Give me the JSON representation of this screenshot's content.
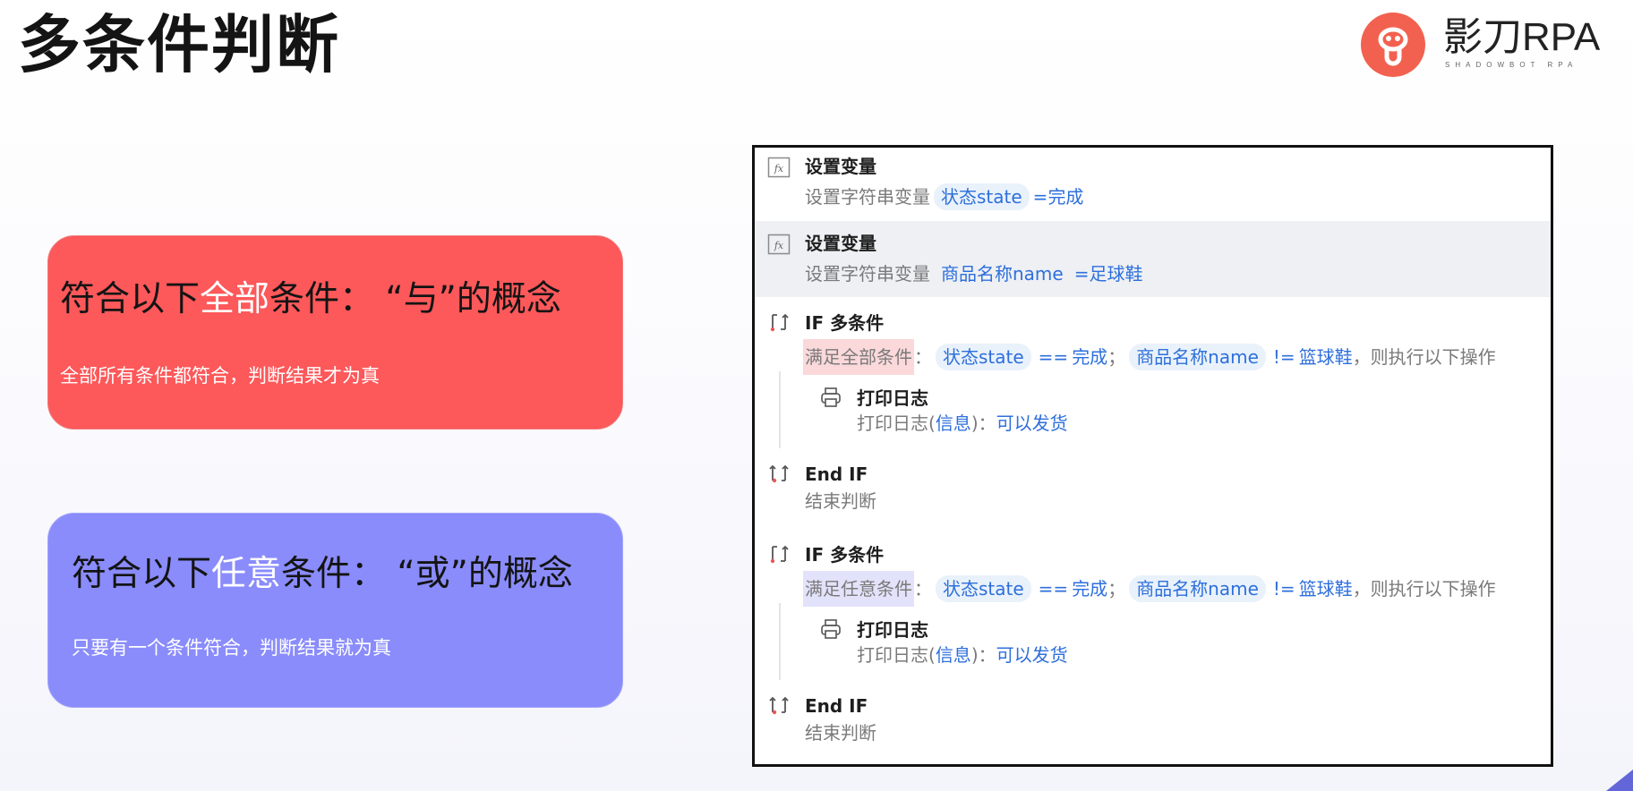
{
  "page_title": "多条件判断",
  "logo": {
    "name": "影刀RPA",
    "subtitle": "SHADOWBOT RPA",
    "brand_color": "#f2614f"
  },
  "cards": {
    "and": {
      "heading_pre": "符合以下",
      "heading_hl": "全部",
      "heading_post": "条件： “与”的概念",
      "desc": "全部所有条件都符合，判断结果才为真",
      "color": "#fd585a"
    },
    "or": {
      "heading_pre": "符合以下",
      "heading_hl": "任意",
      "heading_post": "条件： “或”的概念",
      "desc": "只要有一个条件符合，判断结果就为真",
      "color": "#8a8cfb"
    }
  },
  "flow": {
    "set1": {
      "icon": "fx-icon",
      "title": "设置变量",
      "label": "设置字符串变量",
      "var": "状态state",
      "eq": "=",
      "value": "完成"
    },
    "set2": {
      "icon": "fx-icon",
      "title": "设置变量",
      "label": "设置字符串变量",
      "var": "商品名称name",
      "eq": "=",
      "value": "足球鞋"
    },
    "if1": {
      "icon": "if-branch-icon",
      "title": "IF 多条件",
      "cond_label": "满足全部条件",
      "colon": "：",
      "var1": "状态state",
      "op1": "==",
      "val1": "完成",
      "sep": "；",
      "var2": "商品名称name",
      "op2": "!=",
      "val2": "篮球鞋",
      "suffix": "，则执行以下操作"
    },
    "log1": {
      "icon": "printer-icon",
      "title": "打印日志",
      "label": "打印日志(",
      "param": "信息",
      "close": ")：",
      "value": "可以发货"
    },
    "end1": {
      "icon": "end-if-icon",
      "title": "End IF",
      "detail": "结束判断"
    },
    "if2": {
      "icon": "if-branch-icon",
      "title": "IF 多条件",
      "cond_label": "满足任意条件",
      "colon": "：",
      "var1": "状态state",
      "op1": "==",
      "val1": "完成",
      "sep": "；",
      "var2": "商品名称name",
      "op2": "!=",
      "val2": "篮球鞋",
      "suffix": "，则执行以下操作"
    },
    "log2": {
      "icon": "printer-icon",
      "title": "打印日志",
      "label": "打印日志(",
      "param": "信息",
      "close": ")：",
      "value": "可以发货"
    },
    "end2": {
      "icon": "end-if-icon",
      "title": "End IF",
      "detail": "结束判断"
    }
  }
}
